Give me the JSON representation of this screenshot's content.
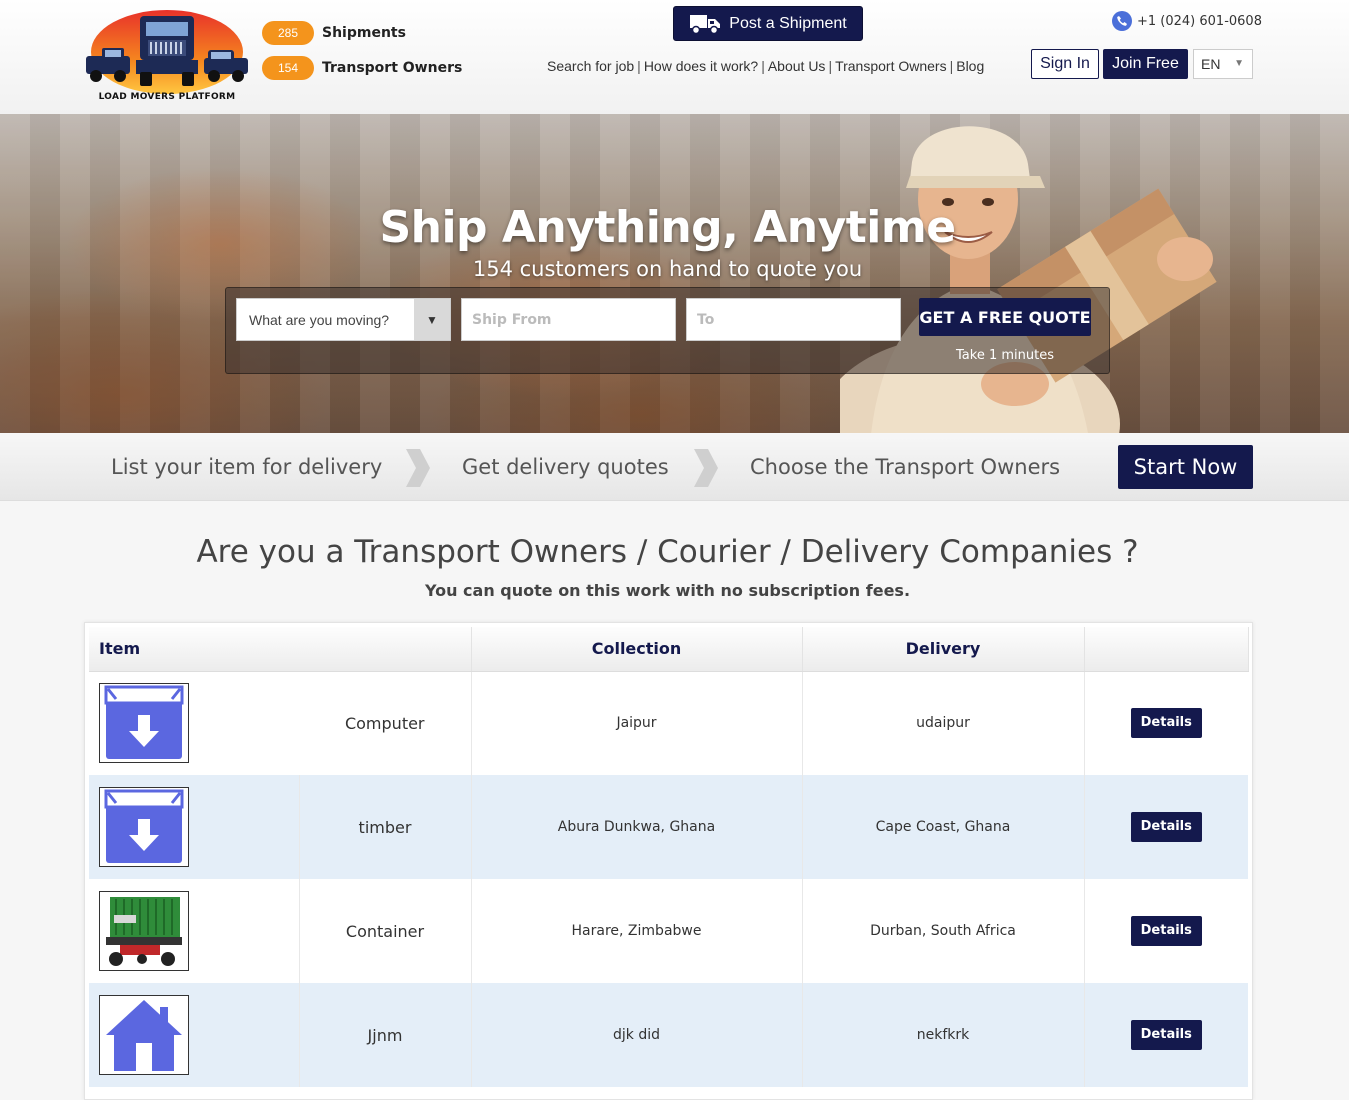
{
  "header": {
    "logo_text": "LOAD MOVERS PLATFORM",
    "stats": [
      {
        "count": "285",
        "label": "Shipments"
      },
      {
        "count": "154",
        "label": "Transport Owners"
      }
    ],
    "post_button": "Post a Shipment",
    "nav": [
      "Search for job",
      "How does it work?",
      "About Us",
      "Transport Owners",
      "Blog"
    ],
    "phone": "+1 (024) 601-0608",
    "sign_in": "Sign In",
    "join_free": "Join Free",
    "language": "EN"
  },
  "hero": {
    "title": "Ship Anything, Anytime",
    "subtitle": "154 customers on hand to quote you",
    "select_placeholder": "What are you moving?",
    "from_placeholder": "Ship From",
    "to_placeholder": "To",
    "quote_button": "GET A FREE QUOTE",
    "quote_note": "Take 1 minutes"
  },
  "steps": {
    "items": [
      "List your item for delivery",
      "Get delivery quotes",
      "Choose the Transport Owners"
    ],
    "start_button": "Start Now"
  },
  "section": {
    "title": "Are you a Transport Owners / Courier / Delivery Companies ?",
    "subtitle": "You can quote on this work with no subscription fees."
  },
  "table": {
    "headers": [
      "Item",
      "Collection",
      "Delivery",
      ""
    ],
    "rows": [
      {
        "icon": "box-download-icon",
        "item": "Computer",
        "collection": "Jaipur",
        "delivery": "udaipur",
        "action": "Details"
      },
      {
        "icon": "box-download-icon",
        "item": "timber",
        "collection": "Abura Dunkwa, Ghana",
        "delivery": "Cape Coast, Ghana",
        "action": "Details"
      },
      {
        "icon": "container-truck-icon",
        "item": "Container",
        "collection": "Harare, Zimbabwe",
        "delivery": "Durban, South Africa",
        "action": "Details"
      },
      {
        "icon": "house-icon",
        "item": "Jjnm",
        "collection": "djk did",
        "delivery": "nekfkrk",
        "action": "Details"
      }
    ]
  },
  "colors": {
    "brand_navy": "#14194d",
    "badge_orange": "#f4941c",
    "alt_row": "#e4eef8",
    "icon_blue": "#5b67e0"
  }
}
